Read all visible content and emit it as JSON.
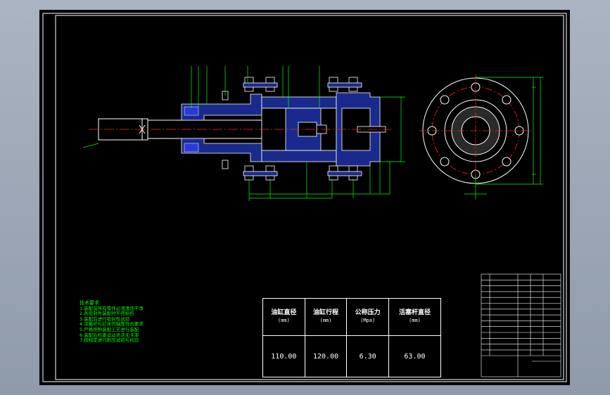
{
  "parameter_table": {
    "headers": [
      {
        "label": "油缸直径",
        "unit": "(mm)"
      },
      {
        "label": "油缸行程",
        "unit": "(mm)"
      },
      {
        "label": "公称压力",
        "unit": "(Mpa)"
      },
      {
        "label": "活塞杆直径",
        "unit": "(mm)"
      }
    ],
    "values": [
      "110.00",
      "120.00",
      "6.30",
      "63.00"
    ]
  },
  "tech_notes": {
    "title": "技术要求",
    "lines": [
      "1.装配前所有零件必须清洗干净",
      "2.各密封件装配时不得损伤",
      "3.装配后进行密封性试验",
      "4.活塞杆与缸体同轴度符合要求",
      "5.严格按照装配工艺进行装配",
      "6.装配后检查运动灵活无卡滞",
      "7.按规定进行耐压试验与检验"
    ]
  },
  "colors": {
    "background": "#000000",
    "body_fill": "#1a2a8c",
    "dimension_lines": "#00ff00",
    "outline": "#ffffff",
    "center_lines": "#ff2020",
    "hatch": "#3a4ad0"
  }
}
